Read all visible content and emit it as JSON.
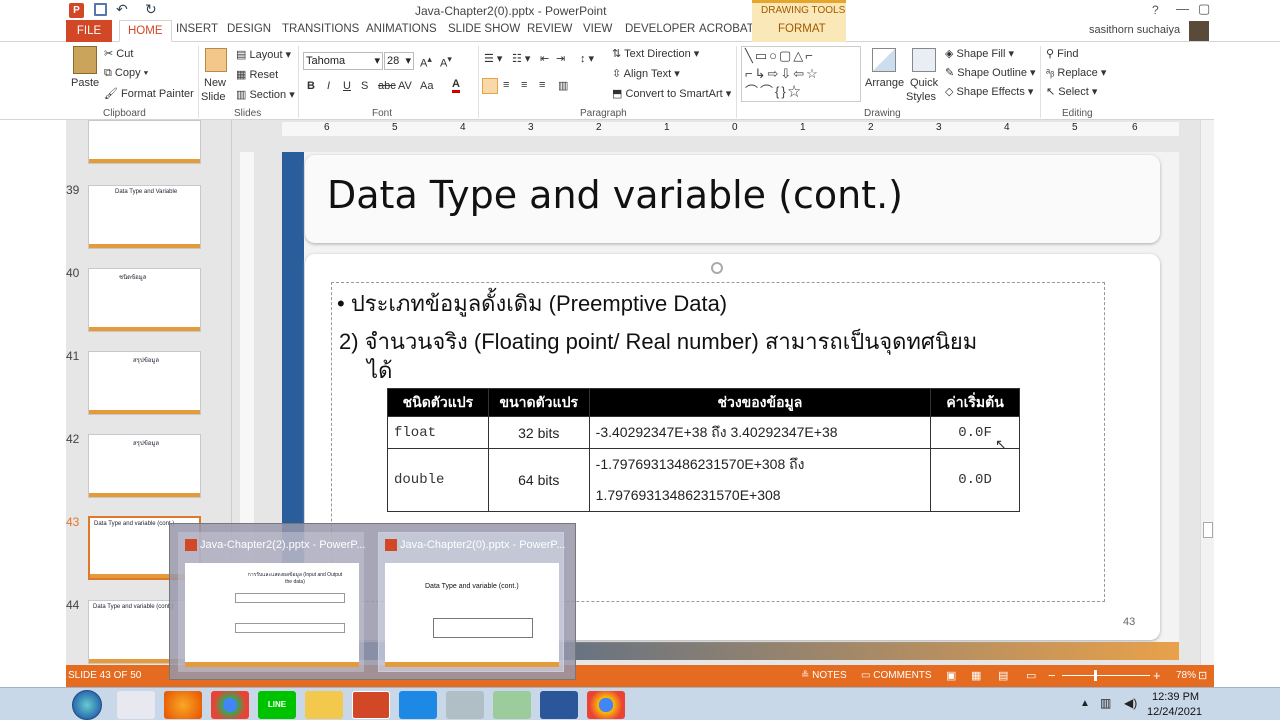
{
  "window": {
    "title": "Java-Chapter2(0).pptx - PowerPoint",
    "help": "?"
  },
  "drawing_tools": "DRAWING TOOLS",
  "tabs": [
    "FILE",
    "HOME",
    "INSERT",
    "DESIGN",
    "TRANSITIONS",
    "ANIMATIONS",
    "SLIDE SHOW",
    "REVIEW",
    "VIEW",
    "DEVELOPER",
    "ACROBAT",
    "FORMAT"
  ],
  "user": "sasithorn suchaiya",
  "ribbon": {
    "clipboard": {
      "paste": "Paste",
      "cut": "Cut",
      "copy": "Copy",
      "format_painter": "Format Painter",
      "label": "Clipboard"
    },
    "slides": {
      "new_slide_1": "New",
      "new_slide_2": "Slide",
      "layout": "Layout",
      "reset": "Reset",
      "section": "Section",
      "label": "Slides"
    },
    "font": {
      "name": "Tahoma",
      "size": "28",
      "label": "Font"
    },
    "paragraph": {
      "text_direction": "Text Direction",
      "align_text": "Align Text",
      "convert": "Convert to SmartArt",
      "label": "Paragraph"
    },
    "drawing": {
      "arrange": "Arrange",
      "quick_1": "Quick",
      "quick_2": "Styles",
      "shape_fill": "Shape Fill",
      "shape_outline": "Shape Outline",
      "shape_effects": "Shape Effects",
      "label": "Drawing"
    },
    "editing": {
      "find": "Find",
      "replace": "Replace",
      "select": "Select",
      "label": "Editing"
    }
  },
  "ruler": [
    "6",
    "5",
    "4",
    "3",
    "2",
    "1",
    "0",
    "1",
    "2",
    "3",
    "4",
    "5",
    "6"
  ],
  "thumbnails": [
    {
      "num": "39",
      "title": "Data Type and Variable"
    },
    {
      "num": "40",
      "title": "ชนิดข้อมูล"
    },
    {
      "num": "41",
      "title": "สรุปข้อมูล"
    },
    {
      "num": "42",
      "title": "สรุปข้อมูล"
    },
    {
      "num": "43",
      "title": "Data Type and variable (cont.)"
    },
    {
      "num": "44",
      "title": "Data Type and variable (cont.)"
    }
  ],
  "slide": {
    "title": "Data Type and variable (cont.)",
    "bullet": "• ประเภทข้อมูลดั้งเดิม (Preemptive Data)",
    "point_line1": "2) จำนวนจริง (Floating point/ Real number) สามารถเป็นจุดทศนิยม",
    "point_line2": "ได้",
    "table": {
      "headers": [
        "ชนิดตัวแปร",
        "ขนาดตัวแปร",
        "ช่วงของข้อมูล",
        "ค่าเริ่มต้น"
      ],
      "rows": [
        {
          "type": "float",
          "size": "32 bits",
          "range1": "-3.40292347E+38 ถึง 3.40292347E+38",
          "range2": "",
          "default": "0.0F"
        },
        {
          "type": "double",
          "size": "64 bits",
          "range1": "-1.79769313486231570E+308 ถึง",
          "range2": "1.79769313486231570E+308",
          "default": "0.0D"
        }
      ]
    },
    "page_number": "43"
  },
  "preview": {
    "win1": "Java-Chapter2(2).pptx - PowerP...",
    "win2": "Java-Chapter2(0).pptx - PowerP...",
    "win1_title": "การรับและแสดงผลข้อมูล (Input and Output the data)",
    "win2_title": "Data Type and variable (cont.)"
  },
  "status": {
    "slide_info": "SLIDE 43 OF 50",
    "notes": "NOTES",
    "comments": "COMMENTS",
    "zoom": "78%"
  },
  "taskbar": {
    "time": "12:39 PM",
    "date": "12/24/2021",
    "line": "LINE"
  },
  "colors": {
    "accent": "#d24726",
    "status": "#e46b1f",
    "slide_blue": "#2a5d9c"
  }
}
